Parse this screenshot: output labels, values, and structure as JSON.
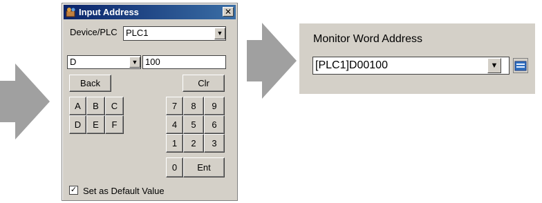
{
  "dialog": {
    "title": "Input Address",
    "device_plc_label": "Device/PLC",
    "device_plc_value": "PLC1",
    "type_value": "D",
    "address_value": "100",
    "keys": {
      "back": "Back",
      "clr": "Clr",
      "a": "A",
      "b": "B",
      "c": "C",
      "d": "D",
      "e": "E",
      "f": "F",
      "n7": "7",
      "n8": "8",
      "n9": "9",
      "n4": "4",
      "n5": "5",
      "n6": "6",
      "n1": "1",
      "n2": "2",
      "n3": "3",
      "n0": "0",
      "ent": "Ent"
    },
    "default_checkbox_label": "Set as Default Value",
    "default_checked": true
  },
  "monitor": {
    "label": "Monitor Word Address",
    "value": "[PLC1]D00100"
  },
  "colors": {
    "arrow": "#a0a0a0",
    "dialog_bg": "#d4d0c8",
    "title_bar": "#0a246a"
  }
}
